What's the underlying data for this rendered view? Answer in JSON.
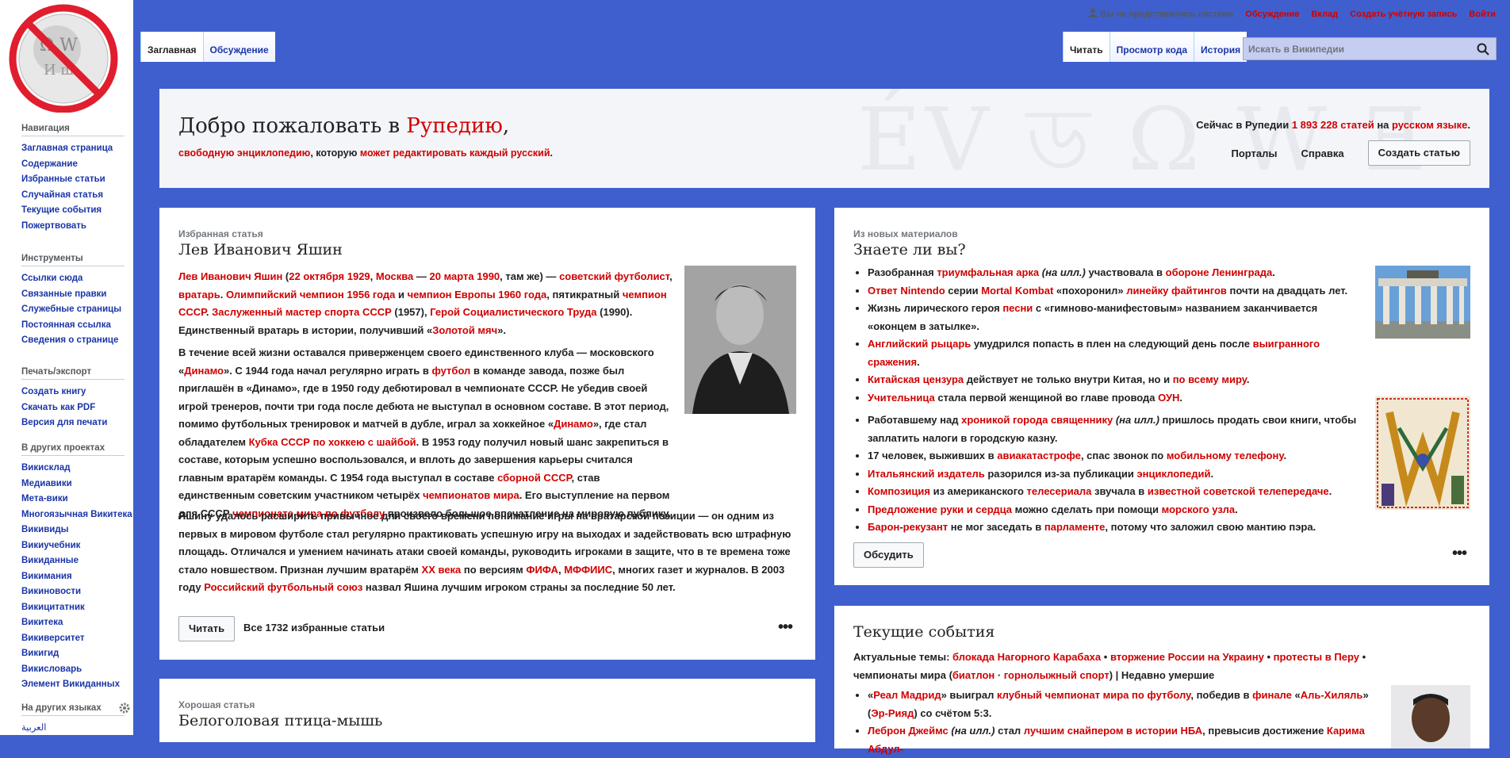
{
  "sidebar": {
    "sections": [
      {
        "title": "Навигация",
        "items": [
          "Заглавная страница",
          "Содержание",
          "Избранные статьи",
          "Случайная статья",
          "Текущие события",
          "Пожертвовать"
        ]
      },
      {
        "title": "Инструменты",
        "items": [
          "Ссылки сюда",
          "Связанные правки",
          "Служебные страницы",
          "Постоянная ссылка",
          "Сведения о странице"
        ]
      },
      {
        "title": "Печать/экспорт",
        "items": [
          "Создать книгу",
          "Скачать как PDF",
          "Версия для печати"
        ]
      },
      {
        "title": "В других проектах",
        "items": [
          "Викисклад",
          "Медиавики",
          "Мета-вики",
          "Многоязычная Викитека",
          "Викивиды",
          "Викиучебник",
          "Викиданные",
          "Викимания",
          "Викиновости",
          "Викицитатник",
          "Викитека",
          "Викиверситет",
          "Викигид",
          "Викисловарь",
          "Элемент Викиданных"
        ]
      },
      {
        "title": "На других языках",
        "items": [
          "العربية"
        ]
      }
    ]
  },
  "personal": {
    "anon": "Вы не представились системе",
    "links": [
      "Обсуждение",
      "Вклад",
      "Создать учётную запись",
      "Войти"
    ]
  },
  "tabs_left": [
    "Заглавная",
    "Обсуждение"
  ],
  "tabs_right": [
    "Читать",
    "Просмотр кода",
    "История"
  ],
  "search": {
    "placeholder": "Искать в Википедии"
  },
  "welcome": {
    "title_prefix": "Добро пожаловать в ",
    "title_link": "Рупедию",
    "title_suffix": ",",
    "sub_link1": "свободную энциклопедию",
    "sub_text": ", которую ",
    "sub_link2": "может редактировать каждый русский",
    "sub_end": ".",
    "count_prefix": "Сейчас в Рупедии ",
    "count_link": "1 893 228 статей",
    "count_mid": " на ",
    "count_lang": "русском языке",
    "count_end": ".",
    "portals": "Порталы",
    "help": "Справка",
    "create": "Создать статью"
  },
  "featured": {
    "label": "Избранная статья",
    "title": "Лев Иванович Яшин",
    "read": "Читать",
    "all": "Все 1732 избранные статьи",
    "more": "•••"
  },
  "dyk": {
    "label": "Из новых материалов",
    "title": "Знаете ли вы?",
    "discuss": "Обсудить",
    "more": "•••"
  },
  "good": {
    "label": "Хорошая статья",
    "title": "Белоголовая птица-мышь"
  },
  "events": {
    "title": "Текущие события",
    "topics_label": "Актуальные темы:",
    "topic1": "блокада Нагорного Карабаха",
    "topic2": "вторжение России на Украину",
    "topic3": "протесты в Перу",
    "topic4": "чемпионаты мира",
    "topic5": "биатлон",
    "topic6": "горнолыжный спорт",
    "recent": "Недавно умершие"
  },
  "colors": {
    "accent_link": "#d00000",
    "background": "#3f5fce",
    "nav_link": "#1a35a8"
  }
}
